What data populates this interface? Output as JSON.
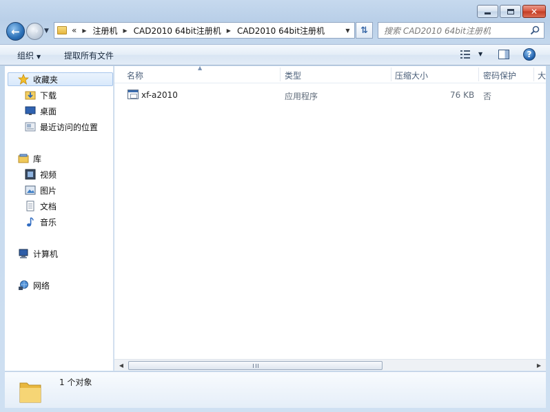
{
  "window": {
    "controls": {
      "minimize": "minimize",
      "maximize": "maximize",
      "close": "✕"
    }
  },
  "navigation": {
    "overflow": "«",
    "breadcrumbs": [
      "注册机",
      "CAD2010 64bit注册机",
      "CAD2010 64bit注册机"
    ],
    "search_placeholder": "搜索 CAD2010 64bit注册机"
  },
  "toolbar": {
    "organize_label": "组织",
    "extract_label": "提取所有文件"
  },
  "sidebar": {
    "favorites": {
      "label": "收藏夹",
      "icon": "star-icon"
    },
    "favorites_items": [
      {
        "label": "下载",
        "icon": "download-folder-icon"
      },
      {
        "label": "桌面",
        "icon": "desktop-icon"
      },
      {
        "label": "最近访问的位置",
        "icon": "recent-places-icon"
      }
    ],
    "libraries": {
      "label": "库",
      "icon": "library-icon"
    },
    "libraries_items": [
      {
        "label": "视频",
        "icon": "video-icon"
      },
      {
        "label": "图片",
        "icon": "pictures-icon"
      },
      {
        "label": "文档",
        "icon": "documents-icon"
      },
      {
        "label": "音乐",
        "icon": "music-icon"
      }
    ],
    "computer": {
      "label": "计算机",
      "icon": "computer-icon"
    },
    "network": {
      "label": "网络",
      "icon": "network-icon"
    }
  },
  "file_list": {
    "columns": [
      "名称",
      "类型",
      "压缩大小",
      "密码保护",
      "大"
    ],
    "rows": [
      {
        "name": "xf-a2010",
        "type": "应用程序",
        "compressed_size": "76 KB",
        "password_protected": "否",
        "icon": "application-icon"
      }
    ]
  },
  "details": {
    "status": "1 个对象"
  },
  "colors": {
    "frame": "#c6d9ee",
    "toolbar": "#e4edf7",
    "selection": "#d9e9fb",
    "header_text": "#4c607a"
  }
}
